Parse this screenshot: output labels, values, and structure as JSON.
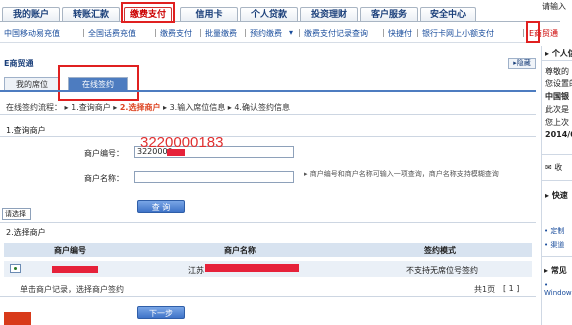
{
  "login_hint": "请输入",
  "top_tabs": [
    "我的账户",
    "转账汇款",
    "缴费支付",
    "信用卡",
    "个人贷款",
    "投资理财",
    "客户服务",
    "安全中心"
  ],
  "sub_nav": [
    "中国移动易充值",
    "全国话费充值",
    "缴费支付",
    "批量缴费",
    "预约缴费",
    "缴费支付记录查询",
    "快捷付",
    "银行卡网上小额支付",
    "E商贸通"
  ],
  "page_title": "E商贸通",
  "hide_button": "隐藏",
  "content_tabs": [
    "我的席位",
    "在线签约"
  ],
  "flow": {
    "prefix": "在线签约流程：",
    "step1": "1.查询商户",
    "step2": "2.选择商户",
    "step3": "3.输入席位信息",
    "step4": "4.确认签约信息"
  },
  "section1_title": "1.查询商户",
  "merchant_no_label": "商户编号：",
  "merchant_no_value": "3220000",
  "annotation": "3220000183",
  "merchant_name_label": "商户名称：",
  "merchant_name_value": "",
  "hint_text": "商户编号和商户名称可输入一项查询，商户名称支持模糊查询",
  "query_button": "查 询",
  "section2_title": "2.选择商户",
  "table": {
    "headers": [
      "商户编号",
      "商户名称",
      "签约模式"
    ],
    "rows": [
      {
        "merchant_no": "",
        "merchant_name": "江苏",
        "mode": "不支持无席位号签约"
      }
    ]
  },
  "footer_hint": "单击商户记录，选择商户签约",
  "pagination": {
    "total": "共1页",
    "page": "[ 1 ]"
  },
  "next_button": "下一步",
  "right_panel": {
    "header": "个人信",
    "lines": [
      "尊敬的",
      "您设置的",
      "中国银",
      "此次是",
      "您上次",
      "2014/0"
    ],
    "favorites": "收",
    "quick_header": "快速",
    "select": "请选择",
    "links": [
      "定制",
      "渠道"
    ],
    "common_header": "常见",
    "windows": "Window"
  },
  "colors": {
    "brand_red": "#e02020",
    "tab_blue": "#4d7cc0",
    "link_blue": "#1a4d9c"
  }
}
